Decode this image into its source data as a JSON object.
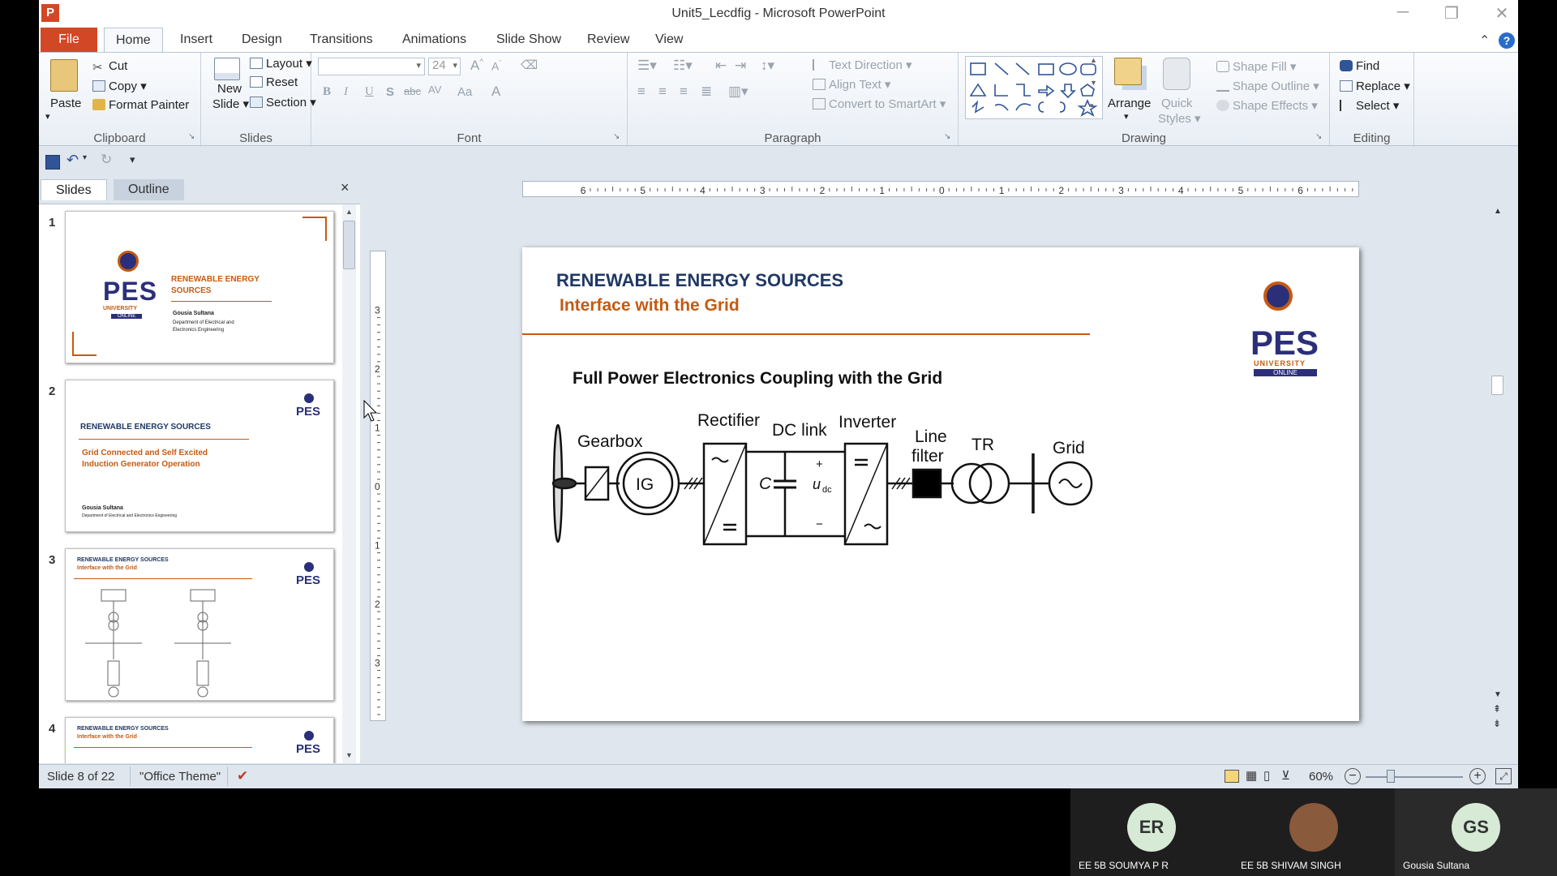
{
  "window": {
    "title": "Unit5_Lecdfig  -  Microsoft PowerPoint",
    "app_icon": "P"
  },
  "ribbon_tabs": [
    "File",
    "Home",
    "Insert",
    "Design",
    "Transitions",
    "Animations",
    "Slide Show",
    "Review",
    "View"
  ],
  "clipboard": {
    "paste": "Paste",
    "cut": "Cut",
    "copy": "Copy",
    "format_painter": "Format Painter",
    "label": "Clipboard"
  },
  "slides_group": {
    "new_slide_1": "New",
    "new_slide_2": "Slide",
    "layout": "Layout",
    "reset": "Reset",
    "section": "Section",
    "label": "Slides"
  },
  "font": {
    "size": "24",
    "label": "Font",
    "bold": "B",
    "italic": "I",
    "underline": "U",
    "shadow": "S",
    "strike": "abc",
    "spacing": "AV",
    "case": "Aa",
    "color": "A"
  },
  "paragraph": {
    "text_direction": "Text Direction",
    "align_text": "Align Text",
    "convert_smartart": "Convert to SmartArt",
    "label": "Paragraph"
  },
  "drawing": {
    "arrange": "Arrange",
    "quick_styles_1": "Quick",
    "quick_styles_2": "Styles",
    "shape_fill": "Shape Fill",
    "shape_outline": "Shape Outline",
    "shape_effects": "Shape Effects",
    "label": "Drawing"
  },
  "editing": {
    "find": "Find",
    "replace": "Replace",
    "select": "Select",
    "label": "Editing"
  },
  "panel": {
    "tab_slides": "Slides",
    "tab_outline": "Outline",
    "close": "×"
  },
  "thumbnails": [
    {
      "num": "1",
      "title_1": "RENEWABLE ENERGY",
      "title_2": "SOURCES",
      "author": "Gousia Sultana",
      "dept_1": "Department of Electrical and",
      "dept_2": "Electronics Engineering"
    },
    {
      "num": "2",
      "title": "RENEWABLE ENERGY SOURCES",
      "sub_1": "Grid Connected and Self Excited",
      "sub_2": "Induction Generator Operation",
      "author": "Gousia Sultana",
      "dept": "Department of Electrical and Electronics Engineering"
    },
    {
      "num": "3",
      "title": "RENEWABLE ENERGY SOURCES",
      "sub": "Interface with the Grid"
    },
    {
      "num": "4",
      "title": "RENEWABLE ENERGY SOURCES",
      "sub": "Interface with the Grid"
    }
  ],
  "logo": {
    "pes": "PES",
    "university": "UNIVERSITY",
    "online": "ONLINE"
  },
  "ruler_h": [
    "6",
    "5",
    "4",
    "3",
    "2",
    "1",
    "0",
    "1",
    "2",
    "3",
    "4",
    "5",
    "6"
  ],
  "ruler_v": [
    "3",
    "2",
    "1",
    "0",
    "1",
    "2",
    "3"
  ],
  "slide": {
    "title": "RENEWABLE ENERGY SOURCES",
    "subtitle": "Interface with the Grid",
    "heading": "Full Power Electronics Coupling with the Grid",
    "diagram": {
      "gearbox": "Gearbox",
      "ig": "IG",
      "rectifier": "Rectifier",
      "dc_link": "DC link",
      "inverter": "Inverter",
      "line": "Line",
      "filter": "filter",
      "tr": "TR",
      "grid": "Grid",
      "cap": "C",
      "udc": "u",
      "udc_sub": "dc",
      "plus": "+",
      "minus": "−"
    }
  },
  "status": {
    "slide_info": "Slide 8 of 22",
    "theme": "\"Office Theme\"",
    "zoom": "60%"
  },
  "participants": [
    {
      "initials": "ER",
      "name": "EE 5B SOUMYA P R",
      "color": "#d6ead6"
    },
    {
      "initials": "",
      "name": "EE 5B SHIVAM SINGH",
      "color": "#8a5a3c"
    },
    {
      "initials": "GS",
      "name": "Gousia  Sultana",
      "color": "#d6ead6"
    }
  ]
}
